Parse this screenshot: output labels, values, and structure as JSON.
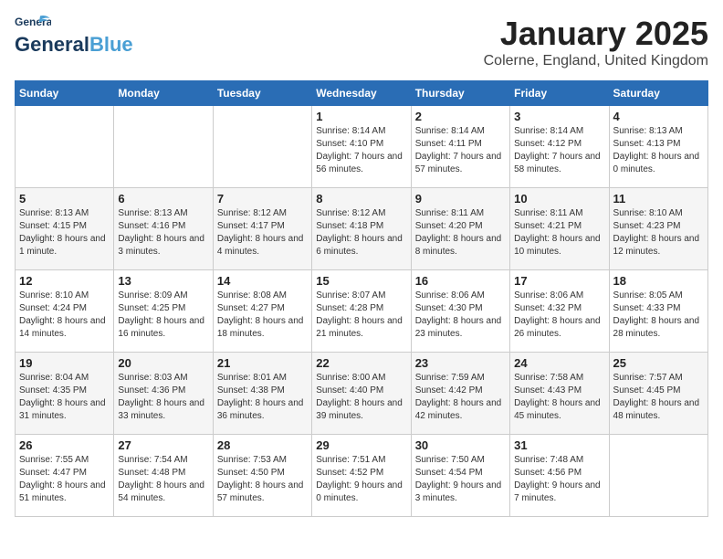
{
  "logo": {
    "text_general": "General",
    "text_blue": "Blue"
  },
  "header": {
    "month": "January 2025",
    "location": "Colerne, England, United Kingdom"
  },
  "weekdays": [
    "Sunday",
    "Monday",
    "Tuesday",
    "Wednesday",
    "Thursday",
    "Friday",
    "Saturday"
  ],
  "weeks": [
    [
      {
        "day": "",
        "info": ""
      },
      {
        "day": "",
        "info": ""
      },
      {
        "day": "",
        "info": ""
      },
      {
        "day": "1",
        "info": "Sunrise: 8:14 AM\nSunset: 4:10 PM\nDaylight: 7 hours and 56 minutes."
      },
      {
        "day": "2",
        "info": "Sunrise: 8:14 AM\nSunset: 4:11 PM\nDaylight: 7 hours and 57 minutes."
      },
      {
        "day": "3",
        "info": "Sunrise: 8:14 AM\nSunset: 4:12 PM\nDaylight: 7 hours and 58 minutes."
      },
      {
        "day": "4",
        "info": "Sunrise: 8:13 AM\nSunset: 4:13 PM\nDaylight: 8 hours and 0 minutes."
      }
    ],
    [
      {
        "day": "5",
        "info": "Sunrise: 8:13 AM\nSunset: 4:15 PM\nDaylight: 8 hours and 1 minute."
      },
      {
        "day": "6",
        "info": "Sunrise: 8:13 AM\nSunset: 4:16 PM\nDaylight: 8 hours and 3 minutes."
      },
      {
        "day": "7",
        "info": "Sunrise: 8:12 AM\nSunset: 4:17 PM\nDaylight: 8 hours and 4 minutes."
      },
      {
        "day": "8",
        "info": "Sunrise: 8:12 AM\nSunset: 4:18 PM\nDaylight: 8 hours and 6 minutes."
      },
      {
        "day": "9",
        "info": "Sunrise: 8:11 AM\nSunset: 4:20 PM\nDaylight: 8 hours and 8 minutes."
      },
      {
        "day": "10",
        "info": "Sunrise: 8:11 AM\nSunset: 4:21 PM\nDaylight: 8 hours and 10 minutes."
      },
      {
        "day": "11",
        "info": "Sunrise: 8:10 AM\nSunset: 4:23 PM\nDaylight: 8 hours and 12 minutes."
      }
    ],
    [
      {
        "day": "12",
        "info": "Sunrise: 8:10 AM\nSunset: 4:24 PM\nDaylight: 8 hours and 14 minutes."
      },
      {
        "day": "13",
        "info": "Sunrise: 8:09 AM\nSunset: 4:25 PM\nDaylight: 8 hours and 16 minutes."
      },
      {
        "day": "14",
        "info": "Sunrise: 8:08 AM\nSunset: 4:27 PM\nDaylight: 8 hours and 18 minutes."
      },
      {
        "day": "15",
        "info": "Sunrise: 8:07 AM\nSunset: 4:28 PM\nDaylight: 8 hours and 21 minutes."
      },
      {
        "day": "16",
        "info": "Sunrise: 8:06 AM\nSunset: 4:30 PM\nDaylight: 8 hours and 23 minutes."
      },
      {
        "day": "17",
        "info": "Sunrise: 8:06 AM\nSunset: 4:32 PM\nDaylight: 8 hours and 26 minutes."
      },
      {
        "day": "18",
        "info": "Sunrise: 8:05 AM\nSunset: 4:33 PM\nDaylight: 8 hours and 28 minutes."
      }
    ],
    [
      {
        "day": "19",
        "info": "Sunrise: 8:04 AM\nSunset: 4:35 PM\nDaylight: 8 hours and 31 minutes."
      },
      {
        "day": "20",
        "info": "Sunrise: 8:03 AM\nSunset: 4:36 PM\nDaylight: 8 hours and 33 minutes."
      },
      {
        "day": "21",
        "info": "Sunrise: 8:01 AM\nSunset: 4:38 PM\nDaylight: 8 hours and 36 minutes."
      },
      {
        "day": "22",
        "info": "Sunrise: 8:00 AM\nSunset: 4:40 PM\nDaylight: 8 hours and 39 minutes."
      },
      {
        "day": "23",
        "info": "Sunrise: 7:59 AM\nSunset: 4:42 PM\nDaylight: 8 hours and 42 minutes."
      },
      {
        "day": "24",
        "info": "Sunrise: 7:58 AM\nSunset: 4:43 PM\nDaylight: 8 hours and 45 minutes."
      },
      {
        "day": "25",
        "info": "Sunrise: 7:57 AM\nSunset: 4:45 PM\nDaylight: 8 hours and 48 minutes."
      }
    ],
    [
      {
        "day": "26",
        "info": "Sunrise: 7:55 AM\nSunset: 4:47 PM\nDaylight: 8 hours and 51 minutes."
      },
      {
        "day": "27",
        "info": "Sunrise: 7:54 AM\nSunset: 4:48 PM\nDaylight: 8 hours and 54 minutes."
      },
      {
        "day": "28",
        "info": "Sunrise: 7:53 AM\nSunset: 4:50 PM\nDaylight: 8 hours and 57 minutes."
      },
      {
        "day": "29",
        "info": "Sunrise: 7:51 AM\nSunset: 4:52 PM\nDaylight: 9 hours and 0 minutes."
      },
      {
        "day": "30",
        "info": "Sunrise: 7:50 AM\nSunset: 4:54 PM\nDaylight: 9 hours and 3 minutes."
      },
      {
        "day": "31",
        "info": "Sunrise: 7:48 AM\nSunset: 4:56 PM\nDaylight: 9 hours and 7 minutes."
      },
      {
        "day": "",
        "info": ""
      }
    ]
  ]
}
